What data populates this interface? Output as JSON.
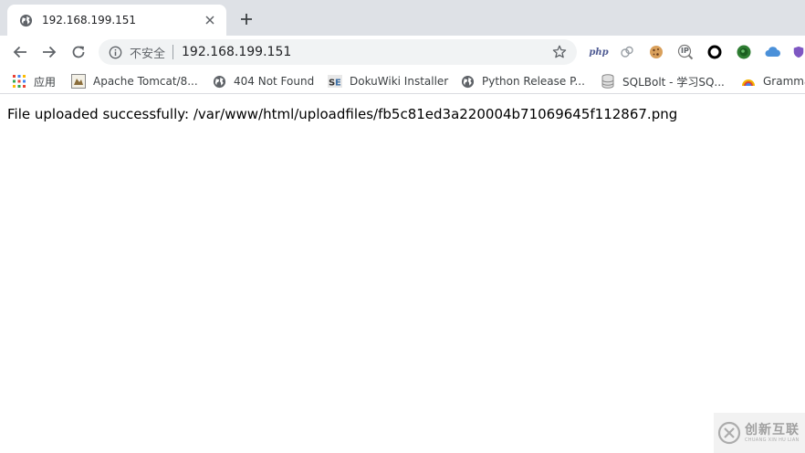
{
  "tab": {
    "title": "192.168.199.151"
  },
  "toolbar": {
    "security_label": "不安全",
    "url": "192.168.199.151"
  },
  "extensions": [
    {
      "icon": "php-icon",
      "label": "php"
    },
    {
      "icon": "clouds-icon"
    },
    {
      "icon": "cookie-icon"
    },
    {
      "icon": "ip-icon",
      "label": "IP"
    },
    {
      "icon": "ring-icon"
    },
    {
      "icon": "green-circle-icon"
    },
    {
      "icon": "cloud-icon"
    },
    {
      "icon": "shield-icon"
    }
  ],
  "bookmarks": {
    "apps_label": "应用",
    "items": [
      {
        "icon": "tomcat-icon",
        "label": "Apache Tomcat/8..."
      },
      {
        "icon": "globe-icon",
        "label": "404 Not Found"
      },
      {
        "icon": "dokuwiki-icon",
        "label": "DokuWiki Installer"
      },
      {
        "icon": "globe-icon",
        "label": "Python Release P..."
      },
      {
        "icon": "database-icon",
        "label": "SQLBolt - 学习SQ..."
      },
      {
        "icon": "grammarly-icon",
        "label": "Gramma"
      }
    ]
  },
  "page": {
    "message": "File uploaded successfully: /var/www/html/uploadfiles/fb5c81ed3a220004b71069645f112867.png"
  },
  "watermark": {
    "main": "创新互联",
    "sub": "CHUANG XIN HU LIAN"
  }
}
